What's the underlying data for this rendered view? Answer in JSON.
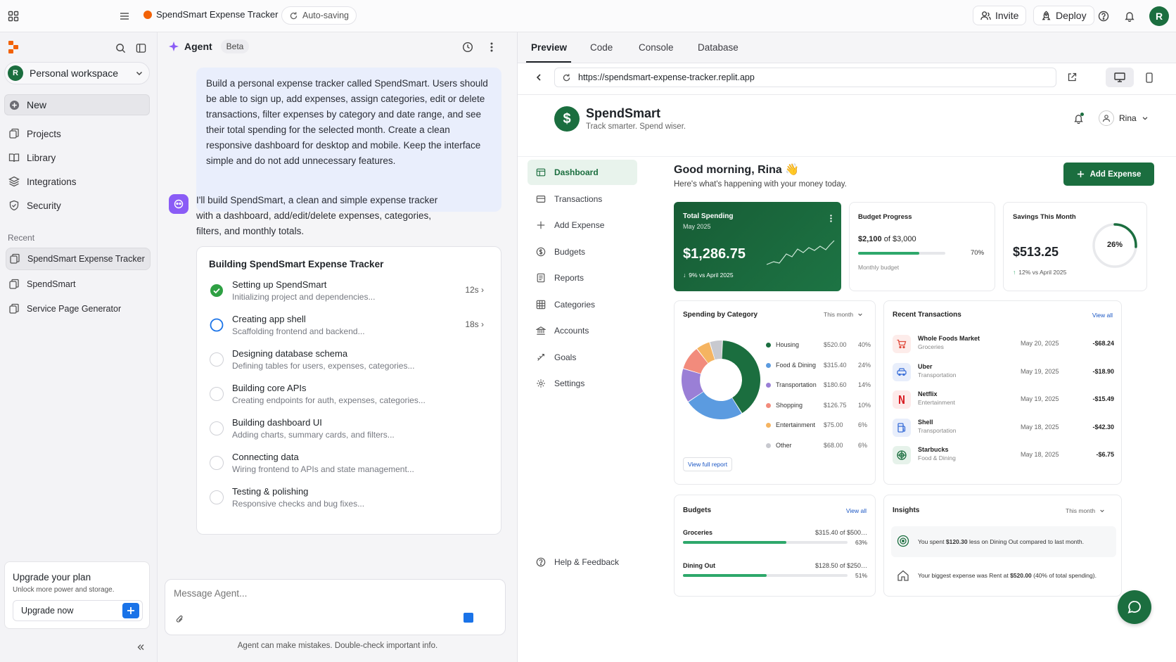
{
  "topbar": {
    "project_title": "SpendSmart Expense Tracker",
    "status": "Auto-saving",
    "invite_label": "Invite",
    "deploy_label": "Deploy",
    "avatar_initial": "R"
  },
  "sidebar": {
    "workspace_initial": "R",
    "workspace_name": "Personal workspace",
    "new_label": "New",
    "items": [
      {
        "label": "Projects",
        "icon": "projects-icon"
      },
      {
        "label": "Library",
        "icon": "book-icon"
      },
      {
        "label": "Integrations",
        "icon": "layers-icon"
      },
      {
        "label": "Security",
        "icon": "shield-icon"
      }
    ],
    "recent_heading": "Recent",
    "recent": [
      {
        "label": "SpendSmart Expense Tracker"
      },
      {
        "label": "SpendSmart"
      },
      {
        "label": "Service Page Generator"
      }
    ],
    "upgrade": {
      "title": "Upgrade your plan",
      "subtitle": "Unlock more power and storage.",
      "button": "Upgrade now"
    }
  },
  "agent": {
    "title": "Agent",
    "badge": "Beta",
    "user_message": "Build a personal expense tracker called SpendSmart. Users should be able to sign up, add expenses, assign categories, edit or delete transactions, filter expenses by category and date range, and see their total spending for the selected month. Create a clean responsive dashboard for desktop and mobile. Keep the interface simple and do not add unnecessary features.",
    "reply": "I'll build SpendSmart, a clean and simple expense tracker with a dashboard, add/edit/delete expenses, categories, filters, and monthly totals.",
    "progress_title": "Building SpendSmart Expense Tracker",
    "tasks": [
      {
        "title": "Setting up SpendSmart",
        "sub": "Initializing project and dependencies...",
        "time": "12s ›",
        "state": "done"
      },
      {
        "title": "Creating app shell",
        "sub": "Scaffolding frontend and backend...",
        "time": "18s ›",
        "state": "active"
      },
      {
        "title": "Designing database schema",
        "sub": "Defining tables for users, expenses, categories...",
        "time": "",
        "state": "pending"
      },
      {
        "title": "Building core APIs",
        "sub": "Creating endpoints for auth, expenses, categories...",
        "time": "",
        "state": "pending"
      },
      {
        "title": "Building dashboard UI",
        "sub": "Adding charts, summary cards, and filters...",
        "time": "",
        "state": "pending"
      },
      {
        "title": "Connecting data",
        "sub": "Wiring frontend to APIs and state management...",
        "time": "",
        "state": "pending"
      },
      {
        "title": "Testing & polishing",
        "sub": "Responsive checks and bug fixes...",
        "time": "",
        "state": "pending"
      }
    ],
    "input_placeholder": "Message Agent...",
    "disclaimer": "Agent can make mistakes. Double-check important info."
  },
  "preview": {
    "tabs": [
      "Preview",
      "Code",
      "Console",
      "Database"
    ],
    "url": "https://spendsmart-expense-tracker.replit.app"
  },
  "app": {
    "brand": "SpendSmart",
    "tagline": "Track smarter. Spend wiser.",
    "user": "Rina",
    "nav": [
      {
        "label": "Dashboard",
        "icon": "dashboard-icon"
      },
      {
        "label": "Transactions",
        "icon": "transactions-icon"
      },
      {
        "label": "Add Expense",
        "icon": "plus-icon"
      },
      {
        "label": "Budgets",
        "icon": "budget-icon"
      },
      {
        "label": "Reports",
        "icon": "reports-icon"
      },
      {
        "label": "Categories",
        "icon": "categories-icon"
      },
      {
        "label": "Accounts",
        "icon": "bank-icon"
      },
      {
        "label": "Goals",
        "icon": "goals-icon"
      },
      {
        "label": "Settings",
        "icon": "settings-icon"
      }
    ],
    "help_label": "Help & Feedback",
    "greeting": "Good morning, Rina 👋",
    "greeting_sub": "Here's what's happening with your money today.",
    "add_expense": "Add Expense",
    "total_spending": {
      "label": "Total Spending",
      "period": "May 2025",
      "value": "$1,286.75",
      "change": "9% vs April 2025"
    },
    "budget_progress": {
      "label": "Budget Progress",
      "amount": "$2,100",
      "of": "of $3,000",
      "percent": "70%",
      "fraction": 0.7,
      "sub": "Monthly budget"
    },
    "savings": {
      "label": "Savings This Month",
      "value": "$513.25",
      "change": "12% vs April 2025",
      "percent": "26%",
      "fraction": 0.26
    },
    "spending_by_category": {
      "title": "Spending by Category",
      "filter": "This month",
      "link": "View full report",
      "categories": [
        {
          "name": "Housing",
          "amount": "$520.00",
          "percent": "40%",
          "value": 520,
          "color": "#1b6e3f"
        },
        {
          "name": "Food & Dining",
          "amount": "$315.40",
          "percent": "24%",
          "value": 315.4,
          "color": "#5b9be0"
        },
        {
          "name": "Transportation",
          "amount": "$180.60",
          "percent": "14%",
          "value": 180.6,
          "color": "#9a7fd6"
        },
        {
          "name": "Shopping",
          "amount": "$126.75",
          "percent": "10%",
          "value": 126.75,
          "color": "#f28b7c"
        },
        {
          "name": "Entertainment",
          "amount": "$75.00",
          "percent": "6%",
          "value": 75,
          "color": "#f5b461"
        },
        {
          "name": "Other",
          "amount": "$68.00",
          "percent": "6%",
          "value": 68,
          "color": "#c8c9cf"
        }
      ]
    },
    "recent_transactions": {
      "title": "Recent Transactions",
      "link": "View all",
      "rows": [
        {
          "name": "Whole Foods Market",
          "category": "Groceries",
          "date": "May 20, 2025",
          "amount": "-$68.24",
          "icon": "cart-icon",
          "color": "#e0493a",
          "bg": "#fdecea"
        },
        {
          "name": "Uber",
          "category": "Transportation",
          "date": "May 19, 2025",
          "amount": "-$18.90",
          "icon": "car-icon",
          "color": "#3a6fd8",
          "bg": "#e8eefb"
        },
        {
          "name": "Netflix",
          "category": "Entertainment",
          "date": "May 19, 2025",
          "amount": "-$15.49",
          "icon": "netflix-icon",
          "color": "#d81f26",
          "bg": "#fdeaea"
        },
        {
          "name": "Shell",
          "category": "Transportation",
          "date": "May 18, 2025",
          "amount": "-$42.30",
          "icon": "fuel-icon",
          "color": "#3a6fd8",
          "bg": "#e8eefb"
        },
        {
          "name": "Starbucks",
          "category": "Food & Dining",
          "date": "May 18, 2025",
          "amount": "-$6.75",
          "icon": "starbucks-icon",
          "color": "#1b6e3f",
          "bg": "#e6f2ea"
        }
      ]
    },
    "budgets": {
      "title": "Budgets",
      "link": "View all",
      "rows": [
        {
          "name": "Groceries",
          "amount": "$315.40 of $500…",
          "percent": "63%",
          "fraction": 0.63
        },
        {
          "name": "Dining Out",
          "amount": "$128.50 of $250…",
          "percent": "51%",
          "fraction": 0.51
        }
      ]
    },
    "insights": {
      "title": "Insights",
      "filter": "This month",
      "items": [
        {
          "pre": "You spent ",
          "bold": "$120.30",
          "post": " less on Dining Out compared to last month."
        },
        {
          "pre": "Your biggest expense was Rent at ",
          "bold": "$520.00",
          "post": " (40% of total spending)."
        }
      ]
    }
  },
  "colors": {
    "brand_green": "#1b6e3f",
    "accent_blue": "#1a73e8",
    "replit_orange": "#f26207"
  }
}
